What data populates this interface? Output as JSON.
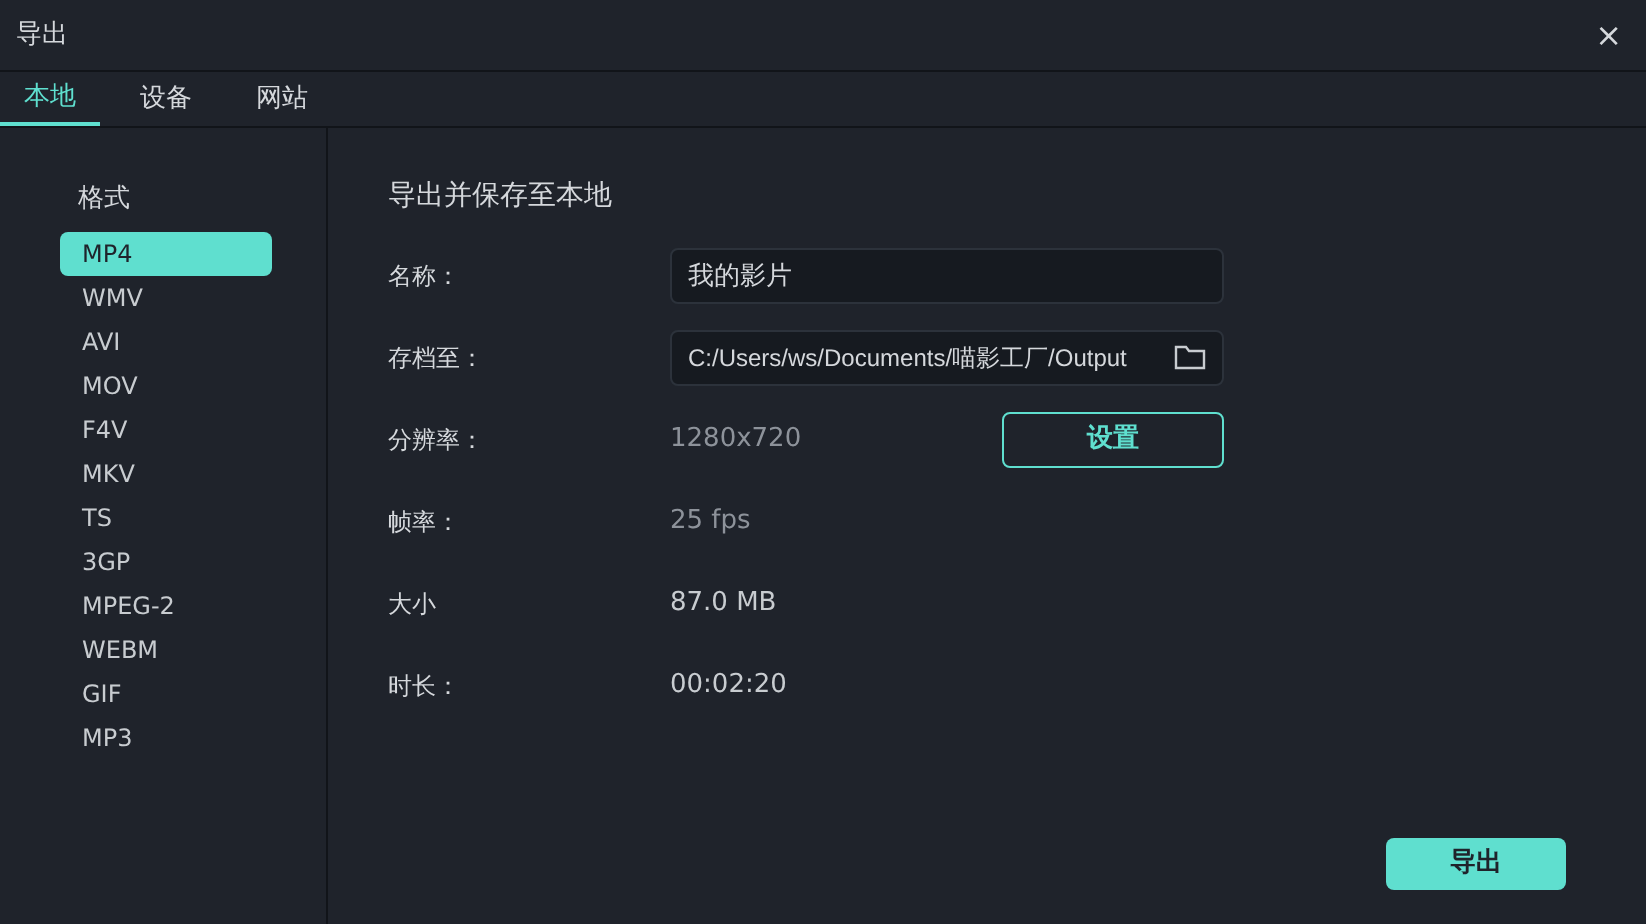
{
  "window": {
    "title": "导出",
    "close": "×"
  },
  "tabs": [
    {
      "label": "本地",
      "selected": true
    },
    {
      "label": "设备",
      "selected": false
    },
    {
      "label": "网站",
      "selected": false
    }
  ],
  "formats": {
    "heading": "格式",
    "items": [
      {
        "label": "MP4",
        "selected": true
      },
      {
        "label": "WMV",
        "selected": false
      },
      {
        "label": "AVI",
        "selected": false
      },
      {
        "label": "MOV",
        "selected": false
      },
      {
        "label": "F4V",
        "selected": false
      },
      {
        "label": "MKV",
        "selected": false
      },
      {
        "label": "TS",
        "selected": false
      },
      {
        "label": "3GP",
        "selected": false
      },
      {
        "label": "MPEG-2",
        "selected": false
      },
      {
        "label": "WEBM",
        "selected": false
      },
      {
        "label": "GIF",
        "selected": false
      },
      {
        "label": "MP3",
        "selected": false
      }
    ]
  },
  "settings": {
    "heading": "导出并保存至本地",
    "rows": [
      {
        "kind": "input",
        "label": "名称：",
        "value": "我的影片"
      },
      {
        "kind": "folder",
        "label": "存档至：",
        "value": "C:/Users/ws/Documents/喵影工厂/Output"
      },
      {
        "kind": "button",
        "label": "分辨率：",
        "value": "1280x720",
        "button": "设置"
      },
      {
        "kind": "text",
        "label": "帧率：",
        "value": "25 fps"
      },
      {
        "kind": "text",
        "label": "大小",
        "value": "87.0 MB"
      },
      {
        "kind": "text",
        "label": "时长：",
        "value": "00:02:20"
      }
    ]
  },
  "export_button": "导出"
}
